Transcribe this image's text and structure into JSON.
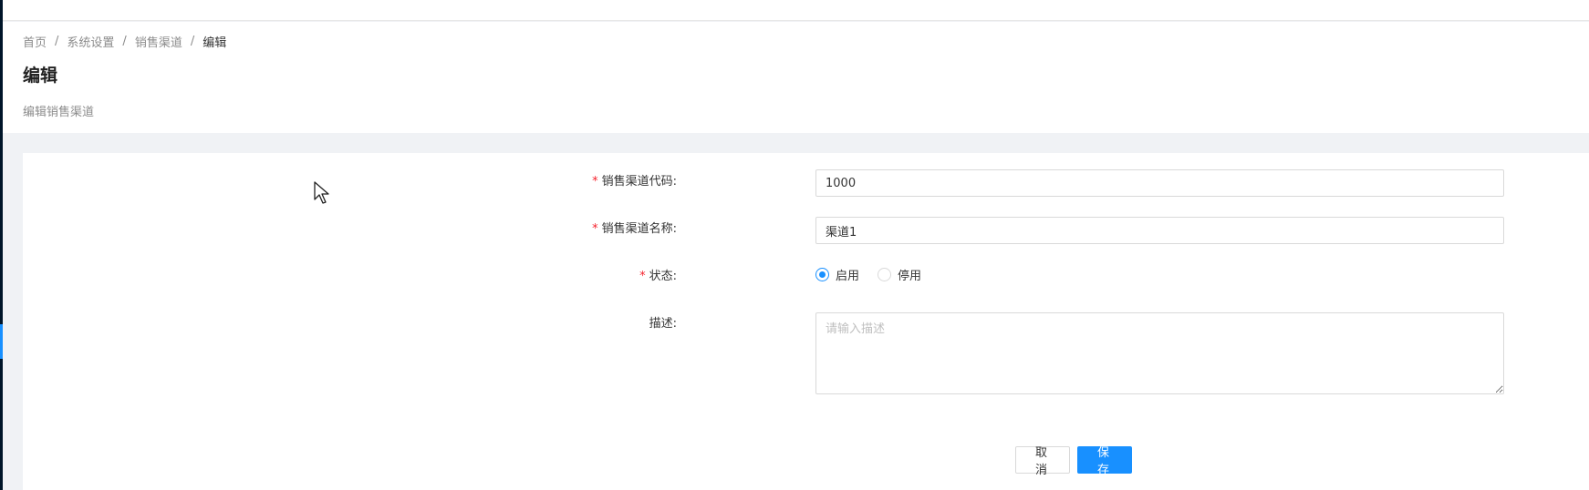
{
  "breadcrumb": {
    "items": [
      "首页",
      "系统设置",
      "销售渠道"
    ],
    "separator": "/",
    "current": "编辑"
  },
  "header": {
    "title": "编辑",
    "subtitle": "编辑销售渠道"
  },
  "form": {
    "code": {
      "label": "销售渠道代码:",
      "required_mark": "*",
      "value": "1000"
    },
    "name": {
      "label": "销售渠道名称:",
      "required_mark": "*",
      "value": "渠道1"
    },
    "status": {
      "label": "状态:",
      "required_mark": "*",
      "options": [
        {
          "label": "启用",
          "checked": true
        },
        {
          "label": "停用",
          "checked": false
        }
      ]
    },
    "description": {
      "label": "描述:",
      "placeholder": "请输入描述",
      "value": ""
    }
  },
  "actions": {
    "cancel_label": "取消",
    "save_label": "保存"
  },
  "colors": {
    "primary": "#1890ff",
    "required": "#f5222d",
    "sidebar": "#001529",
    "background": "#f0f2f5"
  }
}
